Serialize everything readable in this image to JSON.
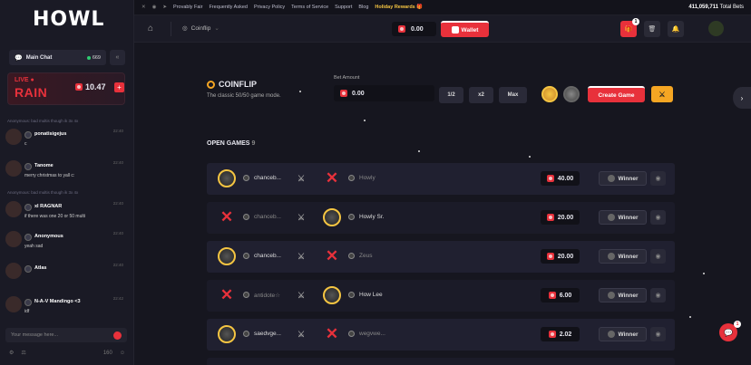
{
  "brand": {
    "logo_text": "HOWL",
    "accent": "#e8313b"
  },
  "sidebar": {
    "chat_title": "Main Chat",
    "online_count": "669",
    "collapse_icon": "«",
    "rain": {
      "live": "LIVE",
      "word": "RAIN",
      "amount": "10.47",
      "plus": "+"
    },
    "sys_msg_1": "Anonymous: bad multis though ik 3x 4x",
    "messages": [
      {
        "name": "ponatisigejus",
        "time": "22:40",
        "text": "c"
      },
      {
        "name": "Tanome",
        "time": "22:40",
        "text": "merry christmas to yall c:"
      },
      {
        "name": "xl RAGNAR",
        "time": "22:40",
        "text": "if there was one 20 or 50 multi"
      },
      {
        "name": "Anonymous",
        "time": "22:40",
        "text": "yeah sad"
      },
      {
        "name": "Atlas",
        "time": "22:40",
        "text": ""
      },
      {
        "name": "N-A-V Mandingo <3",
        "time": "22:42",
        "text": "idf"
      }
    ],
    "sys_msg_2": "Anonymous: bad multis though ik 3x 4x",
    "input_placeholder": "Your message here...",
    "char_limit": "160"
  },
  "topbar": {
    "links": [
      "Provably Fair",
      "Frequently Asked",
      "Privacy Policy",
      "Terms of Service",
      "Support",
      "Blog"
    ],
    "holiday": "Holiday Rewards 🎁",
    "total_bets_value": "411,059,711",
    "total_bets_label": "Total Bets"
  },
  "nav": {
    "game": "Coinflip",
    "balance": "0.00",
    "wallet": "Wallet",
    "notif_count": "1"
  },
  "coinflip": {
    "title": "COINFLIP",
    "subtitle": "The classic 50/50 game mode.",
    "bet_label": "Bet Amount",
    "bet_value": "0.00",
    "half": "1/2",
    "double": "x2",
    "max": "Max",
    "create": "Create Game"
  },
  "open_games": {
    "label": "OPEN GAMES",
    "count": "9",
    "rows": [
      {
        "p1": "chanceb...",
        "p2": "Howly",
        "amount": "40.00",
        "status": "Winner"
      },
      {
        "p1": "chanceb...",
        "p2": "Howly Sr.",
        "amount": "20.00",
        "status": "Winner"
      },
      {
        "p1": "chanceb...",
        "p2": "Zeus",
        "amount": "20.00",
        "status": "Winner"
      },
      {
        "p1": "antidote☆",
        "p2": "How Lee",
        "amount": "6.00",
        "status": "Winner"
      },
      {
        "p1": "saedvge...",
        "p2": "wegvwe...",
        "amount": "2.02",
        "status": "Winner"
      }
    ]
  },
  "float_chat_count": "1"
}
